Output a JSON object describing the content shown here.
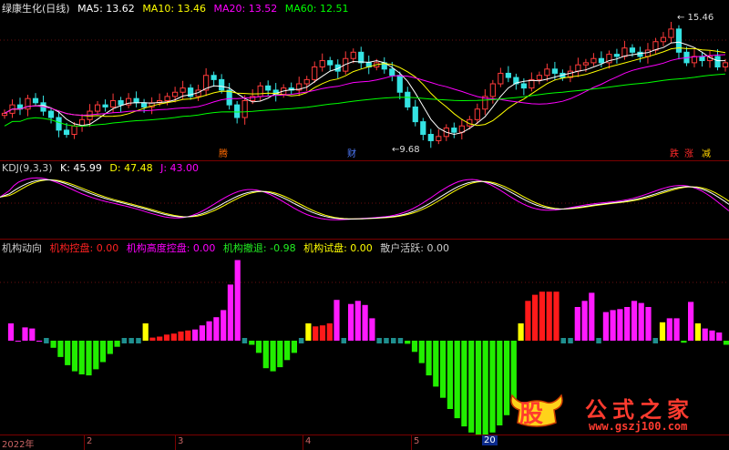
{
  "price_panel": {
    "title": "绿康生化(日线)",
    "ma": [
      {
        "label": "MA5: 13.62",
        "color": "#ffffff"
      },
      {
        "label": "MA10: 13.46",
        "color": "#ffff00"
      },
      {
        "label": "MA20: 13.52",
        "color": "#ff00ff"
      },
      {
        "label": "MA60: 12.51",
        "color": "#00ff00"
      }
    ],
    "high_label": "15.46",
    "low_label": "9.68",
    "markers": [
      {
        "text": "腾",
        "color": "#ff6a00"
      },
      {
        "text": "财",
        "color": "#4f7cff"
      },
      {
        "text": "跌",
        "color": "#ff2a2a"
      },
      {
        "text": "涨",
        "color": "#ff2a2a"
      },
      {
        "text": "减",
        "color": "#ffd400"
      }
    ]
  },
  "kdj_panel": {
    "title": "KDJ(9,3,3)",
    "k": "K: 45.99",
    "d": "D: 47.48",
    "j": "J: 43.00"
  },
  "flow_panel": {
    "title": "机构动向",
    "items": [
      {
        "label": "机构控盘: 0.00",
        "color": "#ff2222"
      },
      {
        "label": "机构高度控盘: 0.00",
        "color": "#ff00ff"
      },
      {
        "label": "机构撤退: -0.98",
        "color": "#22ee22"
      },
      {
        "label": "机构试盘: 0.00",
        "color": "#ffff00"
      },
      {
        "label": "散户活跃: 0.00",
        "color": "#cccccc"
      }
    ]
  },
  "time_axis": {
    "labels": [
      "2022年",
      "2",
      "3",
      "4",
      "5"
    ],
    "end_label": "20"
  },
  "watermark": {
    "logo_text": "股",
    "title": "公式之家",
    "url": "www.gszj100.com"
  },
  "chart_data": [
    {
      "type": "candlestick",
      "title": "绿康生化(日线)",
      "series": [
        {
          "name": "MA5",
          "last": 13.62
        },
        {
          "name": "MA10",
          "last": 13.46
        },
        {
          "name": "MA20",
          "last": 13.52
        },
        {
          "name": "MA60",
          "last": 12.51
        }
      ],
      "close": [
        11.2,
        11.6,
        11.4,
        11.9,
        11.7,
        11.3,
        11.0,
        10.4,
        10.2,
        10.6,
        10.9,
        11.3,
        11.6,
        11.5,
        11.8,
        11.6,
        11.9,
        11.7,
        11.5,
        11.7,
        11.8,
        12.0,
        12.2,
        12.4,
        12.0,
        12.3,
        13.0,
        12.8,
        12.3,
        11.6,
        11.0,
        11.8,
        12.0,
        12.5,
        12.3,
        12.1,
        12.4,
        12.3,
        12.6,
        12.8,
        13.4,
        13.7,
        13.5,
        13.2,
        13.8,
        14.1,
        13.6,
        13.4,
        13.6,
        13.3,
        13.0,
        12.2,
        11.5,
        10.8,
        10.2,
        9.9,
        10.1,
        10.5,
        10.3,
        10.6,
        10.9,
        11.4,
        12.0,
        12.6,
        13.1,
        12.9,
        12.6,
        12.4,
        12.8,
        13.0,
        13.3,
        13.1,
        12.9,
        13.2,
        13.5,
        13.6,
        13.8,
        13.6,
        14.0,
        13.9,
        14.3,
        14.1,
        13.9,
        14.2,
        14.6,
        14.8,
        15.2,
        14.1,
        13.6,
        13.9,
        13.7,
        13.9,
        13.4,
        13.6
      ],
      "annotations": [
        "15.46",
        "9.68"
      ]
    },
    {
      "type": "line",
      "title": "KDJ(9,3,3)",
      "series": [
        {
          "name": "K",
          "last": 45.99
        },
        {
          "name": "D",
          "last": 47.48
        },
        {
          "name": "J",
          "last": 43.0
        }
      ]
    },
    {
      "type": "bar",
      "title": "机构动向",
      "series": [
        {
          "name": "机构控盘",
          "last": 0.0
        },
        {
          "name": "机构高度控盘",
          "last": 0.0
        },
        {
          "name": "机构撤退",
          "last": -0.98
        },
        {
          "name": "机构试盘",
          "last": 0.0
        },
        {
          "name": "散户活跃",
          "last": 0.0
        }
      ],
      "kinds": [
        "m",
        "m",
        "m",
        "m",
        "m",
        "t",
        "g",
        "g",
        "g",
        "g",
        "g",
        "g",
        "g",
        "g",
        "g",
        "g",
        "t",
        "t",
        "t",
        "y",
        "r",
        "r",
        "r",
        "r",
        "r",
        "r",
        "m",
        "m",
        "m",
        "m",
        "m",
        "m",
        "m",
        "t",
        "g",
        "g",
        "g",
        "g",
        "g",
        "g",
        "g",
        "t",
        "y",
        "r",
        "r",
        "r",
        "m",
        "t",
        "m",
        "m",
        "m",
        "m",
        "t",
        "t",
        "t",
        "t",
        "g",
        "g",
        "g",
        "g",
        "g",
        "g",
        "g",
        "g",
        "g",
        "g",
        "g",
        "g",
        "g",
        "g",
        "g",
        "g",
        "y",
        "r",
        "r",
        "r",
        "r",
        "r",
        "t",
        "t",
        "m",
        "m",
        "m",
        "t",
        "m",
        "m",
        "m",
        "m",
        "m",
        "m",
        "m",
        "t",
        "y",
        "m",
        "m",
        "g",
        "m",
        "y",
        "m",
        "m",
        "m",
        "g"
      ],
      "values": [
        0.34,
        0.0,
        0.26,
        0.24,
        0.0,
        0.05,
        -0.14,
        -0.32,
        -0.48,
        -0.6,
        -0.66,
        -0.68,
        -0.56,
        -0.42,
        -0.26,
        -0.12,
        0.05,
        0.05,
        0.04,
        0.34,
        0.06,
        0.08,
        0.12,
        0.14,
        0.18,
        0.2,
        0.22,
        0.3,
        0.38,
        0.46,
        0.6,
        1.1,
        1.58,
        0.05,
        -0.08,
        -0.24,
        -0.54,
        -0.6,
        -0.52,
        -0.38,
        -0.24,
        0.05,
        0.34,
        0.28,
        0.3,
        0.34,
        0.8,
        0.05,
        0.72,
        0.78,
        0.7,
        0.44,
        0.05,
        0.05,
        0.05,
        0.05,
        -0.06,
        -0.22,
        -0.44,
        -0.68,
        -0.9,
        -1.12,
        -1.34,
        -1.52,
        -1.68,
        -1.8,
        -1.86,
        -1.86,
        -1.8,
        -1.66,
        -1.46,
        -1.2,
        0.34,
        0.78,
        0.9,
        0.96,
        0.96,
        0.96,
        0.05,
        0.05,
        0.66,
        0.78,
        0.94,
        0.05,
        0.56,
        0.6,
        0.62,
        0.66,
        0.78,
        0.74,
        0.66,
        0.05,
        0.36,
        0.44,
        0.44,
        -0.04,
        0.76,
        0.34,
        0.24,
        0.2,
        0.16,
        -0.08
      ]
    }
  ]
}
